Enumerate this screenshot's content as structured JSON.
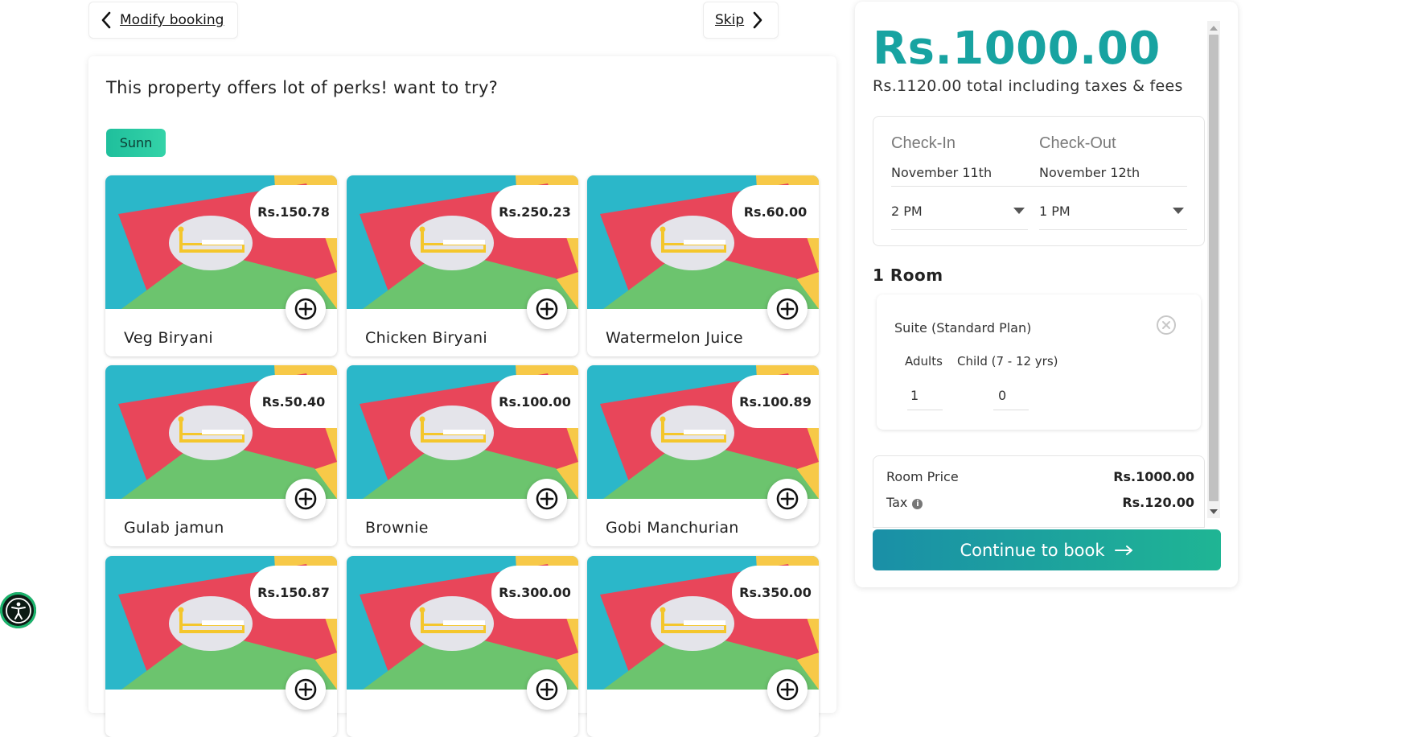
{
  "nav": {
    "modify_label": "Modify booking",
    "skip_label": "Skip"
  },
  "perks": {
    "title": "This property offers lot of perks! want to try?",
    "category": "Sunn",
    "items": [
      {
        "name": "Veg Biryani",
        "price": "Rs.150.78"
      },
      {
        "name": "Chicken Biryani",
        "price": "Rs.250.23"
      },
      {
        "name": "Watermelon Juice",
        "price": "Rs.60.00"
      },
      {
        "name": "Gulab jamun",
        "price": "Rs.50.40"
      },
      {
        "name": "Brownie",
        "price": "Rs.100.00"
      },
      {
        "name": "Gobi Manchurian",
        "price": "Rs.100.89"
      },
      {
        "name": "",
        "price": "Rs.150.87"
      },
      {
        "name": "",
        "price": "Rs.300.00"
      },
      {
        "name": "",
        "price": "Rs.350.00"
      }
    ]
  },
  "summary": {
    "price": "Rs.1000.00",
    "total_text": "Rs.1120.00 total including taxes & fees",
    "checkin_label": "Check-In",
    "checkout_label": "Check-Out",
    "checkin_date": "November 11th",
    "checkout_date": "November 12th",
    "checkin_time": "2 PM",
    "checkout_time": "1 PM",
    "rooms_title": "1 Room",
    "room": {
      "name": "Suite (Standard Plan)",
      "adults_label": "Adults",
      "child_label": "Child (7 - 12 yrs)",
      "adults_value": "1",
      "child_value": "0"
    },
    "room_price_label": "Room Price",
    "room_price_value": "Rs.1000.00",
    "tax_label": "Tax",
    "tax_value": "Rs.120.00",
    "cta_label": "Continue to book"
  },
  "colors": {
    "accent": "#18a3a1",
    "cta_start": "#1a8fa7",
    "cta_end": "#1fb594",
    "chip": "#2ccaa3"
  }
}
